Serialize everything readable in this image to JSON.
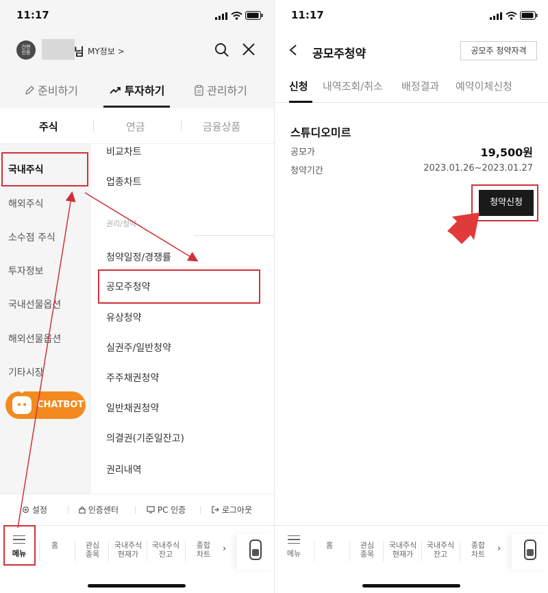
{
  "status_bar": {
    "time": "11:17"
  },
  "left": {
    "header": {
      "auth_badge_line1": "간편",
      "auth_badge_line2": "인증",
      "user_suffix": "님",
      "my_info": "MY정보 >"
    },
    "main_tabs": [
      {
        "label": "준비하기"
      },
      {
        "label": "투자하기"
      },
      {
        "label": "관리하기"
      }
    ],
    "sub_tabs": [
      {
        "label": "주식"
      },
      {
        "label": "연금"
      },
      {
        "label": "금융상품"
      }
    ],
    "side_menu": [
      {
        "label": "국내주식"
      },
      {
        "label": "해외주식"
      },
      {
        "label": "소수점 주식"
      },
      {
        "label": "투자정보"
      },
      {
        "label": "국내선물옵션"
      },
      {
        "label": "해외선물옵션"
      },
      {
        "label": "기타시장"
      }
    ],
    "chatbot_label": "CHATBOT",
    "sub_menu": {
      "top_items": [
        {
          "label": "비교차트"
        },
        {
          "label": "업종차트"
        }
      ],
      "group_label": "권리/청약",
      "items": [
        {
          "label": "청약일정/경쟁률"
        },
        {
          "label": "공모주청약"
        },
        {
          "label": "유상청약"
        },
        {
          "label": "실권주/일반청약"
        },
        {
          "label": "주주채권청약"
        },
        {
          "label": "일반채권청약"
        },
        {
          "label": "의결권(기준일잔고)"
        },
        {
          "label": "권리내역"
        }
      ]
    },
    "footer_links": [
      {
        "label": "설정"
      },
      {
        "label": "인증센터"
      },
      {
        "label": "PC 인증"
      },
      {
        "label": "로그아웃"
      }
    ]
  },
  "bottom_nav": {
    "menu_label": "메뉴",
    "items": [
      {
        "line1": "홈",
        "line2": ""
      },
      {
        "line1": "관심",
        "line2": "종목"
      },
      {
        "line1": "국내주식",
        "line2": "현재가"
      },
      {
        "line1": "국내주식",
        "line2": "잔고"
      },
      {
        "line1": "종합",
        "line2": "차트"
      }
    ]
  },
  "right": {
    "title": "공모주청약",
    "qualification_button": "공모주 청약자격",
    "tabs": [
      {
        "label": "신청"
      },
      {
        "label": "내역조회/취소"
      },
      {
        "label": "배정결과"
      },
      {
        "label": "예약이체신청"
      }
    ],
    "offering": {
      "name": "스튜디오미르",
      "price_label": "공모가",
      "price_value": "19,500원",
      "period_label": "청약기간",
      "period_value": "2023.01.26~2023.01.27"
    },
    "apply_button": "청약신청"
  },
  "colors": {
    "highlight": "#d0303a",
    "chatbot": "#f28a1f",
    "apply_button": "#1a1a1a"
  }
}
